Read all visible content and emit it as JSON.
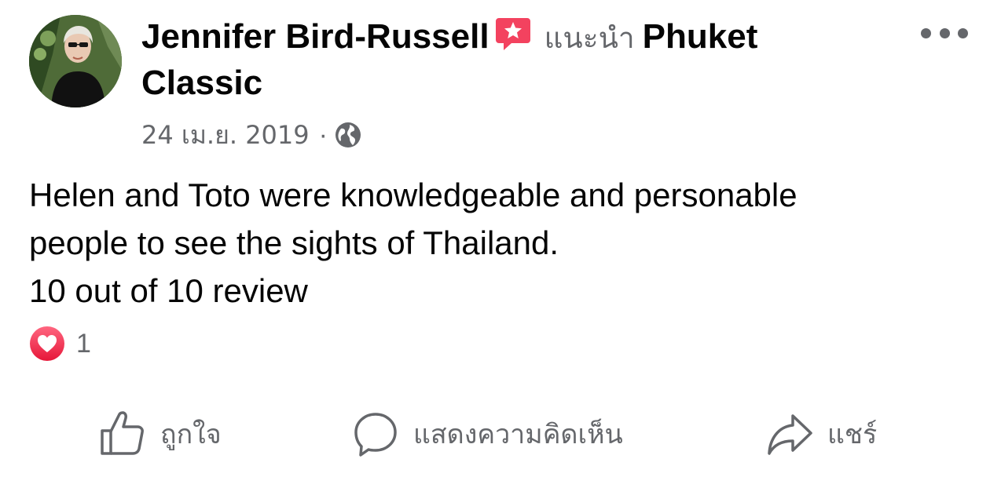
{
  "post": {
    "author": "Jennifer Bird-Russell",
    "verb": "แนะนำ",
    "page_name": "Phuket Classic",
    "date": "24 เม.ย. 2019",
    "separator": "·",
    "audience_icon": "globe-icon",
    "recommend_icon": "recommend-star-icon",
    "text_lines": [
      "Helen and Toto were knowledgeable and personable",
      "people to see the sights of Thailand.",
      "10 out of 10 review"
    ]
  },
  "reactions": {
    "icon": "love-reaction-icon",
    "count": "1"
  },
  "actions": {
    "like_label": "ถูกใจ",
    "comment_label": "แสดงความคิดเห็น",
    "share_label": "แชร์"
  },
  "colors": {
    "text": "#050505",
    "secondary": "#65676b",
    "recommend_red": "#f3425f",
    "love_red": "#f02849"
  }
}
